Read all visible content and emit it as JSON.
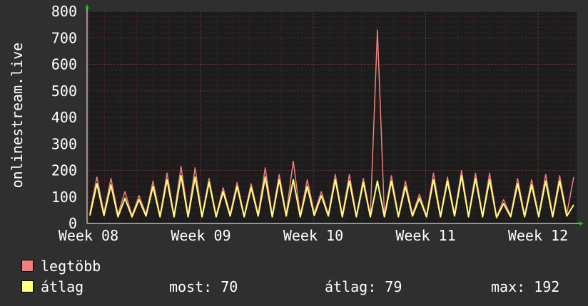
{
  "chart_data": {
    "type": "line",
    "ylabel": "onlinestream.live",
    "ylim": [
      0,
      800
    ],
    "yticks": [
      0,
      100,
      200,
      300,
      400,
      500,
      600,
      700,
      800
    ],
    "xticks": [
      "Week 08",
      "Week 09",
      "Week 10",
      "Week 11",
      "Week 12"
    ],
    "grid": true,
    "x": [
      0,
      0.5,
      1,
      1.5,
      2,
      2.5,
      3,
      3.5,
      4,
      4.5,
      5,
      5.5,
      6,
      6.5,
      7,
      7.5,
      8,
      8.5,
      9,
      9.5,
      10,
      10.5,
      11,
      11.5,
      12,
      12.5,
      13,
      13.5,
      14,
      14.5,
      15,
      15.5,
      16,
      16.5,
      17,
      17.5,
      18,
      18.5,
      19,
      19.5,
      20,
      20.5,
      21,
      21.5,
      22,
      22.5,
      23,
      23.5,
      24,
      24.5,
      25,
      25.5,
      26,
      26.5,
      27,
      27.5,
      28,
      28.5,
      29,
      29.5,
      30,
      30.5,
      31,
      31.5,
      32,
      32.5,
      33,
      33.5,
      34,
      34.5
    ],
    "series": [
      {
        "name": "legtöbb",
        "color": "#f08080",
        "values": [
          40,
          175,
          40,
          170,
          35,
          120,
          30,
          105,
          35,
          160,
          30,
          190,
          30,
          215,
          30,
          210,
          30,
          170,
          30,
          135,
          35,
          155,
          30,
          150,
          35,
          210,
          30,
          185,
          35,
          235,
          30,
          165,
          40,
          120,
          35,
          185,
          30,
          185,
          30,
          170,
          30,
          730,
          30,
          180,
          30,
          160,
          35,
          110,
          30,
          190,
          30,
          175,
          35,
          200,
          30,
          190,
          30,
          190,
          25,
          90,
          30,
          170,
          30,
          165,
          30,
          185,
          30,
          180,
          35,
          175
        ]
      },
      {
        "name": "átlag",
        "color": "#ffff80",
        "values": [
          30,
          150,
          30,
          145,
          25,
          95,
          25,
          90,
          28,
          140,
          25,
          165,
          25,
          180,
          25,
          175,
          25,
          155,
          25,
          120,
          28,
          140,
          25,
          135,
          28,
          175,
          25,
          165,
          28,
          165,
          25,
          140,
          30,
          105,
          28,
          165,
          25,
          160,
          25,
          155,
          25,
          160,
          25,
          160,
          25,
          140,
          28,
          95,
          25,
          165,
          25,
          160,
          28,
          180,
          25,
          170,
          25,
          165,
          22,
          75,
          25,
          150,
          25,
          145,
          25,
          160,
          25,
          160,
          28,
          70
        ]
      }
    ]
  },
  "legend": {
    "max_label": "legtöbb",
    "avg_label": "átlag",
    "max_color": "#f08080",
    "avg_color": "#ffff80"
  },
  "stats": {
    "now": "most: 70",
    "avg": "átlag: 79",
    "max": "max: 192"
  }
}
